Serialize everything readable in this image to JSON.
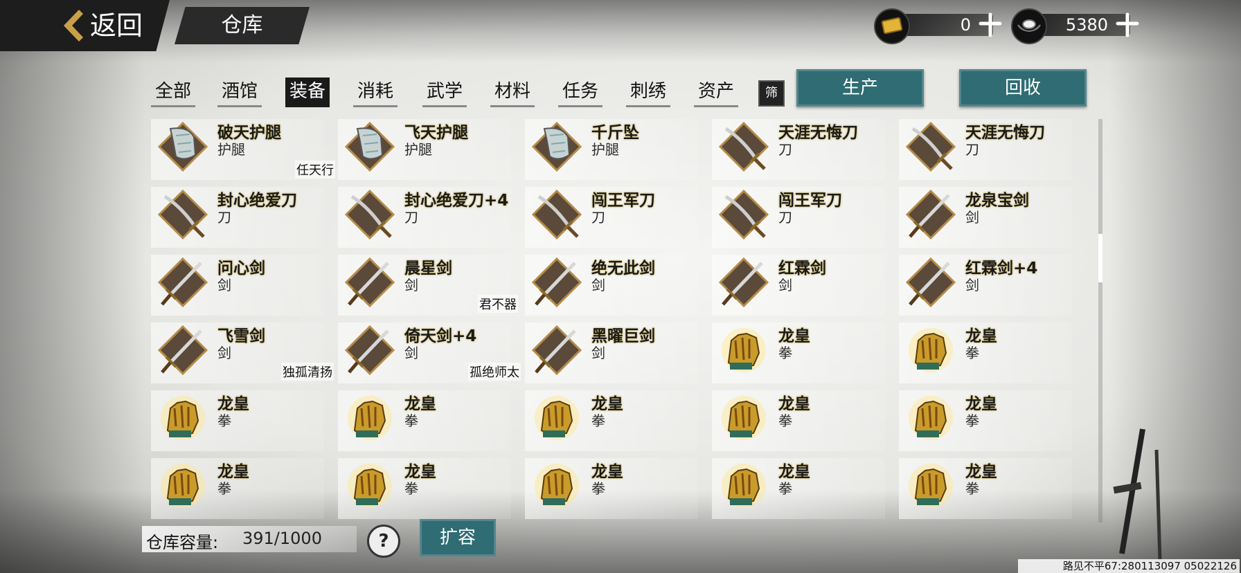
{
  "header": {
    "back_label": "返回",
    "title": "仓库",
    "gold": {
      "icon": "gold-ingot-icon",
      "value": "0"
    },
    "silver": {
      "icon": "silver-ingot-icon",
      "value": "5380"
    }
  },
  "tabs": [
    {
      "label": "全部",
      "active": false
    },
    {
      "label": "酒馆",
      "active": false
    },
    {
      "label": "装备",
      "active": true
    },
    {
      "label": "消耗",
      "active": false
    },
    {
      "label": "武学",
      "active": false
    },
    {
      "label": "材料",
      "active": false
    },
    {
      "label": "任务",
      "active": false
    },
    {
      "label": "刺绣",
      "active": false
    },
    {
      "label": "资产",
      "active": false
    }
  ],
  "filter_label": "筛",
  "actions": {
    "produce": "生产",
    "recycle": "回收"
  },
  "items": [
    {
      "name": "破天护腿",
      "type": "护腿",
      "icon": "leg-armor-icon",
      "equipped_by": "任天行"
    },
    {
      "name": "飞天护腿",
      "type": "护腿",
      "icon": "leg-armor-icon",
      "equipped_by": ""
    },
    {
      "name": "千斤坠",
      "type": "护腿",
      "icon": "leg-armor-icon",
      "equipped_by": ""
    },
    {
      "name": "天涯无悔刀",
      "type": "刀",
      "icon": "saber-icon",
      "equipped_by": ""
    },
    {
      "name": "天涯无悔刀",
      "type": "刀",
      "icon": "saber-icon",
      "equipped_by": ""
    },
    {
      "name": "封心绝爱刀",
      "type": "刀",
      "icon": "saber-icon",
      "equipped_by": ""
    },
    {
      "name": "封心绝爱刀+4",
      "type": "刀",
      "icon": "saber-icon",
      "equipped_by": ""
    },
    {
      "name": "闯王军刀",
      "type": "刀",
      "icon": "saber-icon",
      "equipped_by": ""
    },
    {
      "name": "闯王军刀",
      "type": "刀",
      "icon": "saber-icon",
      "equipped_by": ""
    },
    {
      "name": "龙泉宝剑",
      "type": "剑",
      "icon": "sword-icon",
      "equipped_by": ""
    },
    {
      "name": "问心剑",
      "type": "剑",
      "icon": "sword-icon",
      "equipped_by": ""
    },
    {
      "name": "晨星剑",
      "type": "剑",
      "icon": "sword-icon",
      "equipped_by": "君不器"
    },
    {
      "name": "绝无此剑",
      "type": "剑",
      "icon": "sword-icon",
      "equipped_by": ""
    },
    {
      "name": "红霖剑",
      "type": "剑",
      "icon": "sword-icon",
      "equipped_by": ""
    },
    {
      "name": "红霖剑+4",
      "type": "剑",
      "icon": "sword-icon",
      "equipped_by": ""
    },
    {
      "name": "飞雪剑",
      "type": "剑",
      "icon": "sword-icon",
      "equipped_by": "独孤清扬"
    },
    {
      "name": "倚天剑+4",
      "type": "剑",
      "icon": "sword-icon",
      "equipped_by": "孤绝师太"
    },
    {
      "name": "黑曜巨剑",
      "type": "剑",
      "icon": "sword-icon",
      "equipped_by": ""
    },
    {
      "name": "龙皇",
      "type": "拳",
      "icon": "gauntlet-icon",
      "equipped_by": ""
    },
    {
      "name": "龙皇",
      "type": "拳",
      "icon": "gauntlet-icon",
      "equipped_by": ""
    },
    {
      "name": "龙皇",
      "type": "拳",
      "icon": "gauntlet-icon",
      "equipped_by": ""
    },
    {
      "name": "龙皇",
      "type": "拳",
      "icon": "gauntlet-icon",
      "equipped_by": ""
    },
    {
      "name": "龙皇",
      "type": "拳",
      "icon": "gauntlet-icon",
      "equipped_by": ""
    },
    {
      "name": "龙皇",
      "type": "拳",
      "icon": "gauntlet-icon",
      "equipped_by": ""
    },
    {
      "name": "龙皇",
      "type": "拳",
      "icon": "gauntlet-icon",
      "equipped_by": ""
    },
    {
      "name": "龙皇",
      "type": "拳",
      "icon": "gauntlet-icon",
      "equipped_by": ""
    },
    {
      "name": "龙皇",
      "type": "拳",
      "icon": "gauntlet-icon",
      "equipped_by": ""
    },
    {
      "name": "龙皇",
      "type": "拳",
      "icon": "gauntlet-icon",
      "equipped_by": ""
    },
    {
      "name": "龙皇",
      "type": "拳",
      "icon": "gauntlet-icon",
      "equipped_by": ""
    },
    {
      "name": "龙皇",
      "type": "拳",
      "icon": "gauntlet-icon",
      "equipped_by": ""
    }
  ],
  "footer": {
    "capacity_label": "仓库容量:",
    "capacity_value": "391/1000",
    "help_label": "?",
    "expand_label": "扩容",
    "player_id": "路见不平67:280113097 05022126"
  },
  "colors": {
    "accent_button": "#2f6c73",
    "name_glow": "#d6c27a"
  }
}
